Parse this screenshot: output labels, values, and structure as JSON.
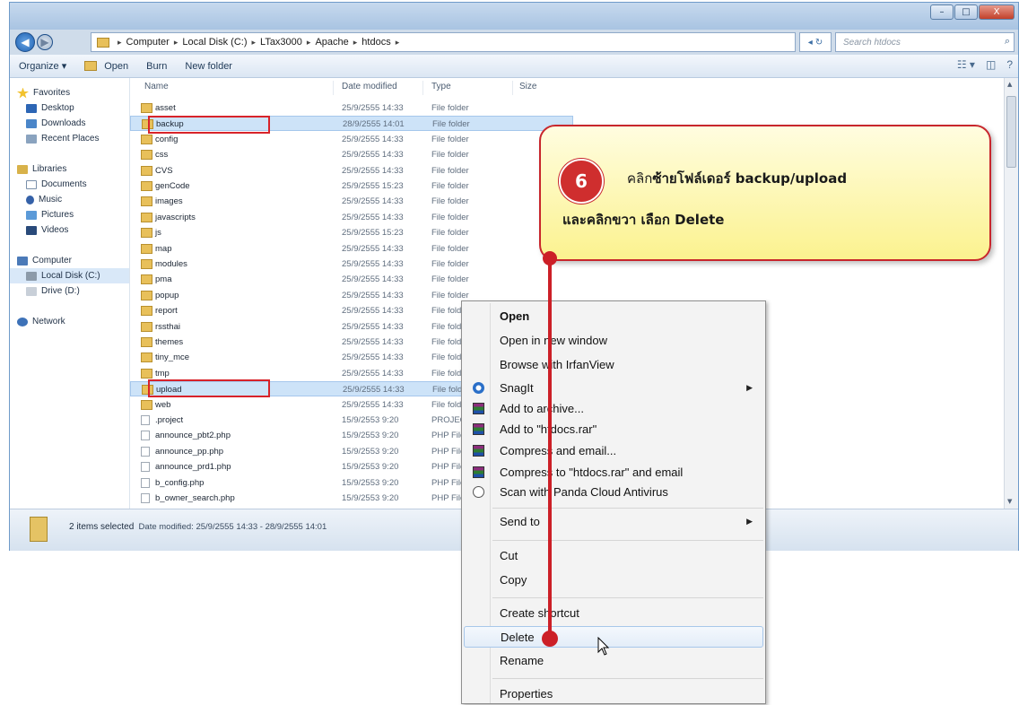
{
  "window": {
    "title_controls": [
      "–",
      "□",
      "X"
    ]
  },
  "address": {
    "crumbs": [
      "Computer",
      "Local Disk (C:)",
      "LTax3000",
      "Apache",
      "htdocs"
    ],
    "refresh": "◂ ↻",
    "search_placeholder": "Search htdocs"
  },
  "toolbar": {
    "organize": "Organize ▾",
    "open": "Open",
    "burn": "Burn",
    "new_folder": "New folder"
  },
  "sidebar": {
    "favorites": "Favorites",
    "desktop": "Desktop",
    "downloads": "Downloads",
    "recent": "Recent Places",
    "libraries": "Libraries",
    "documents": "Documents",
    "music": "Music",
    "pictures": "Pictures",
    "videos": "Videos",
    "computer": "Computer",
    "local_disk": "Local Disk (C:)",
    "drive_d": "Drive (D:)",
    "network": "Network"
  },
  "columns": {
    "name": "Name",
    "date": "Date modified",
    "type": "Type",
    "size": "Size"
  },
  "files": [
    {
      "name": "asset",
      "date": "25/9/2555 14:33",
      "type": "File folder",
      "kind": "folder"
    },
    {
      "name": "backup",
      "date": "28/9/2555 14:01",
      "type": "File folder",
      "kind": "folder",
      "selected": true
    },
    {
      "name": "config",
      "date": "25/9/2555 14:33",
      "type": "File folder",
      "kind": "folder"
    },
    {
      "name": "css",
      "date": "25/9/2555 14:33",
      "type": "File folder",
      "kind": "folder"
    },
    {
      "name": "CVS",
      "date": "25/9/2555 14:33",
      "type": "File folder",
      "kind": "folder"
    },
    {
      "name": "genCode",
      "date": "25/9/2555 15:23",
      "type": "File folder",
      "kind": "folder"
    },
    {
      "name": "images",
      "date": "25/9/2555 14:33",
      "type": "File folder",
      "kind": "folder"
    },
    {
      "name": "javascripts",
      "date": "25/9/2555 14:33",
      "type": "File folder",
      "kind": "folder"
    },
    {
      "name": "js",
      "date": "25/9/2555 15:23",
      "type": "File folder",
      "kind": "folder"
    },
    {
      "name": "map",
      "date": "25/9/2555 14:33",
      "type": "File folder",
      "kind": "folder"
    },
    {
      "name": "modules",
      "date": "25/9/2555 14:33",
      "type": "File folder",
      "kind": "folder"
    },
    {
      "name": "pma",
      "date": "25/9/2555 14:33",
      "type": "File folder",
      "kind": "folder"
    },
    {
      "name": "popup",
      "date": "25/9/2555 14:33",
      "type": "File folder",
      "kind": "folder"
    },
    {
      "name": "report",
      "date": "25/9/2555 14:33",
      "type": "File folder",
      "kind": "folder"
    },
    {
      "name": "rssthai",
      "date": "25/9/2555 14:33",
      "type": "File folder",
      "kind": "folder"
    },
    {
      "name": "themes",
      "date": "25/9/2555 14:33",
      "type": "File folder",
      "kind": "folder"
    },
    {
      "name": "tiny_mce",
      "date": "25/9/2555 14:33",
      "type": "File folder",
      "kind": "folder"
    },
    {
      "name": "tmp",
      "date": "25/9/2555 14:33",
      "type": "File folder",
      "kind": "folder"
    },
    {
      "name": "upload",
      "date": "25/9/2555 14:33",
      "type": "File folder",
      "kind": "folder",
      "selected": true
    },
    {
      "name": "web",
      "date": "25/9/2555 14:33",
      "type": "File folder",
      "kind": "folder"
    },
    {
      "name": ".project",
      "date": "15/9/2553 9:20",
      "type": "PROJECT",
      "kind": "file"
    },
    {
      "name": "announce_pbt2.php",
      "date": "15/9/2553 9:20",
      "type": "PHP File",
      "kind": "file"
    },
    {
      "name": "announce_pp.php",
      "date": "15/9/2553 9:20",
      "type": "PHP File",
      "kind": "file"
    },
    {
      "name": "announce_prd1.php",
      "date": "15/9/2553 9:20",
      "type": "PHP File",
      "kind": "file"
    },
    {
      "name": "b_config.php",
      "date": "15/9/2553 9:20",
      "type": "PHP File",
      "kind": "file"
    },
    {
      "name": "b_owner_search.php",
      "date": "15/9/2553 9:20",
      "type": "PHP File",
      "kind": "file"
    }
  ],
  "status": {
    "selected": "2 items selected",
    "date_label": "Date modified:",
    "date_range": "25/9/2555 14:33 - 28/9/2555 14:01"
  },
  "callout": {
    "step": "6",
    "line1_plain": "คลิก",
    "line1_bold": "ซ้ายโฟล์เดอร์ backup/upload",
    "line2": "และคลิกขวา เลือก  Delete"
  },
  "context_menu": {
    "open": "Open",
    "open_new_window": "Open in new window",
    "browse_irfan": "Browse with IrfanView",
    "snagit": "SnagIt",
    "add_archive": "Add to archive...",
    "add_htdocs_rar": "Add to \"htdocs.rar\"",
    "compress_email": "Compress and email...",
    "compress_htdocs_email": "Compress to \"htdocs.rar\" and email",
    "scan_panda": "Scan with Panda Cloud Antivirus",
    "send_to": "Send to",
    "cut": "Cut",
    "copy": "Copy",
    "create_shortcut": "Create shortcut",
    "delete": "Delete",
    "rename": "Rename",
    "properties": "Properties"
  },
  "colors": {
    "accent_red": "#cc1f27",
    "callout_fill": "#fbf28f",
    "selection": "#cde3f8"
  }
}
